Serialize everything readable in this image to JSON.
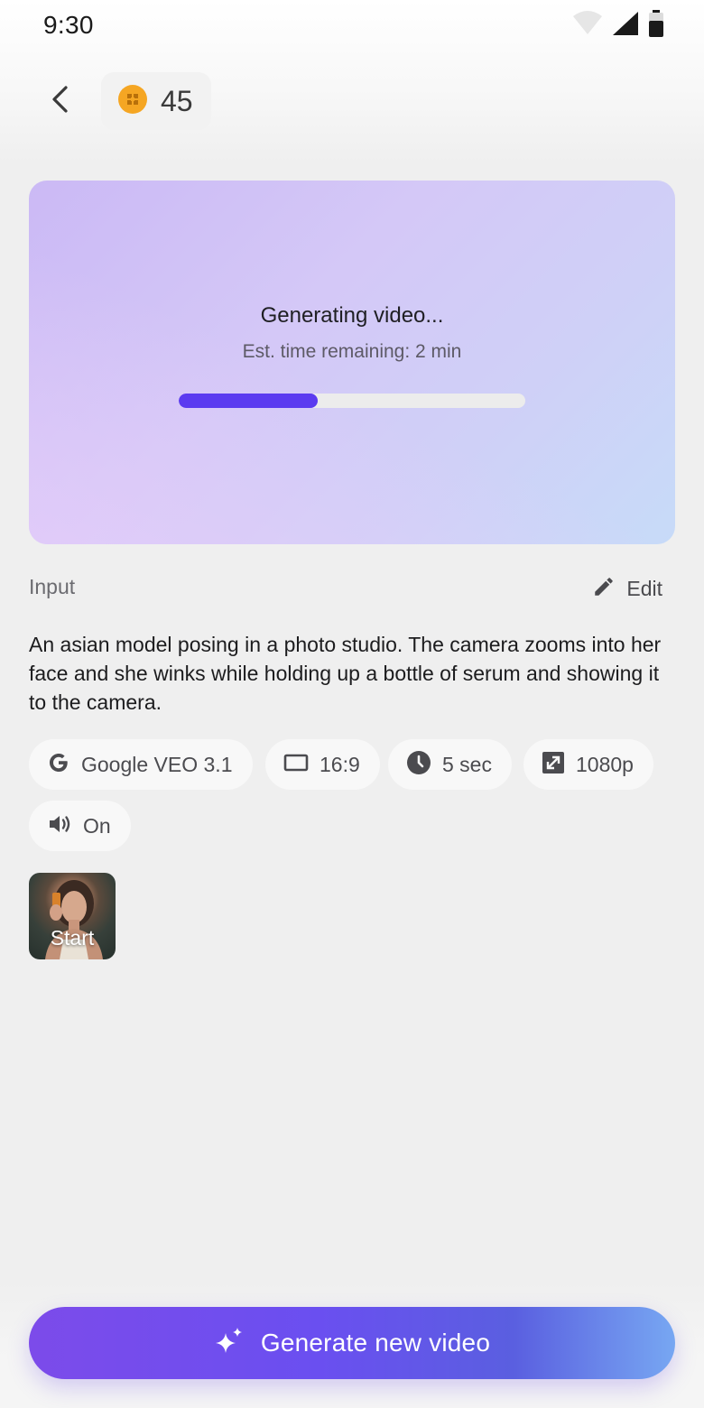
{
  "status_bar": {
    "time": "9:30",
    "icons": [
      "wifi-icon",
      "cellular-signal-icon",
      "battery-icon"
    ]
  },
  "header": {
    "back_icon": "chevron-left-icon",
    "credits": {
      "icon": "coin-icon",
      "count": "45",
      "coin_color": "#f5a623"
    }
  },
  "preview": {
    "title": "Generating video...",
    "subtitle": "Est. time remaining: 2 min",
    "progress": 0.4,
    "progress_color": "#5b3bf0"
  },
  "input_section": {
    "label": "Input",
    "edit_label": "Edit",
    "edit_icon": "pencil-icon",
    "prompt": "An asian model posing in a photo studio. The camera zooms into her face and she winks while holding up a bottle of serum and showing it to the camera."
  },
  "settings_chips": [
    {
      "icon": "google-icon",
      "label": "Google VEO 3.1"
    },
    {
      "icon": "aspect-ratio-icon",
      "label": "16:9"
    },
    {
      "icon": "clock-icon",
      "label": "5 sec"
    },
    {
      "icon": "resolution-icon",
      "label": "1080p"
    },
    {
      "icon": "speaker-icon",
      "label": "On"
    }
  ],
  "start_frame": {
    "label": "Start"
  },
  "generate_button": {
    "label": "Generate new video",
    "icon": "sparkle-icon"
  },
  "colors": {
    "accent": "#5b3bf0",
    "background": "#efefef",
    "button_gradient_start": "#7c4bea",
    "button_gradient_end": "#77a7f2"
  }
}
